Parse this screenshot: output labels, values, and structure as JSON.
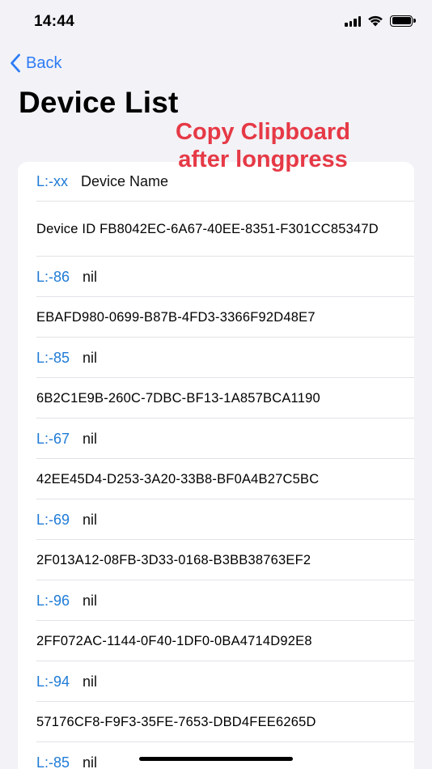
{
  "status_bar": {
    "time": "14:44",
    "icons": [
      "cellular-signal-icon",
      "wifi-icon",
      "battery-icon"
    ]
  },
  "nav": {
    "back_label": "Back",
    "back_icon": "chevron-left-icon"
  },
  "page": {
    "title": "Device List"
  },
  "annotation": {
    "text": "Copy Clipboard after longpress",
    "color": "#e63946"
  },
  "colors": {
    "accent": "#2e7cf6",
    "rssi": "#1f7bd6",
    "background": "#f2f2f7"
  },
  "list": {
    "header": {
      "rssi": "L:-xx",
      "name": "Device Name"
    },
    "header_id": "Device ID FB8042EC-6A67-40EE-8351-F301CC85347D",
    "devices": [
      {
        "rssi": "L:-86",
        "name": "nil",
        "id": "EBAFD980-0699-B87B-4FD3-3366F92D48E7"
      },
      {
        "rssi": "L:-85",
        "name": "nil",
        "id": "6B2C1E9B-260C-7DBC-BF13-1A857BCA1190"
      },
      {
        "rssi": "L:-67",
        "name": "nil",
        "id": "42EE45D4-D253-3A20-33B8-BF0A4B27C5BC"
      },
      {
        "rssi": "L:-69",
        "name": "nil",
        "id": "2F013A12-08FB-3D33-0168-B3BB38763EF2"
      },
      {
        "rssi": "L:-96",
        "name": "nil",
        "id": "2FF072AC-1144-0F40-1DF0-0BA4714D92E8"
      },
      {
        "rssi": "L:-94",
        "name": "nil",
        "id": "57176CF8-F9F3-35FE-7653-DBD4FEE6265D"
      },
      {
        "rssi": "L:-85",
        "name": "nil",
        "id": ""
      }
    ]
  }
}
